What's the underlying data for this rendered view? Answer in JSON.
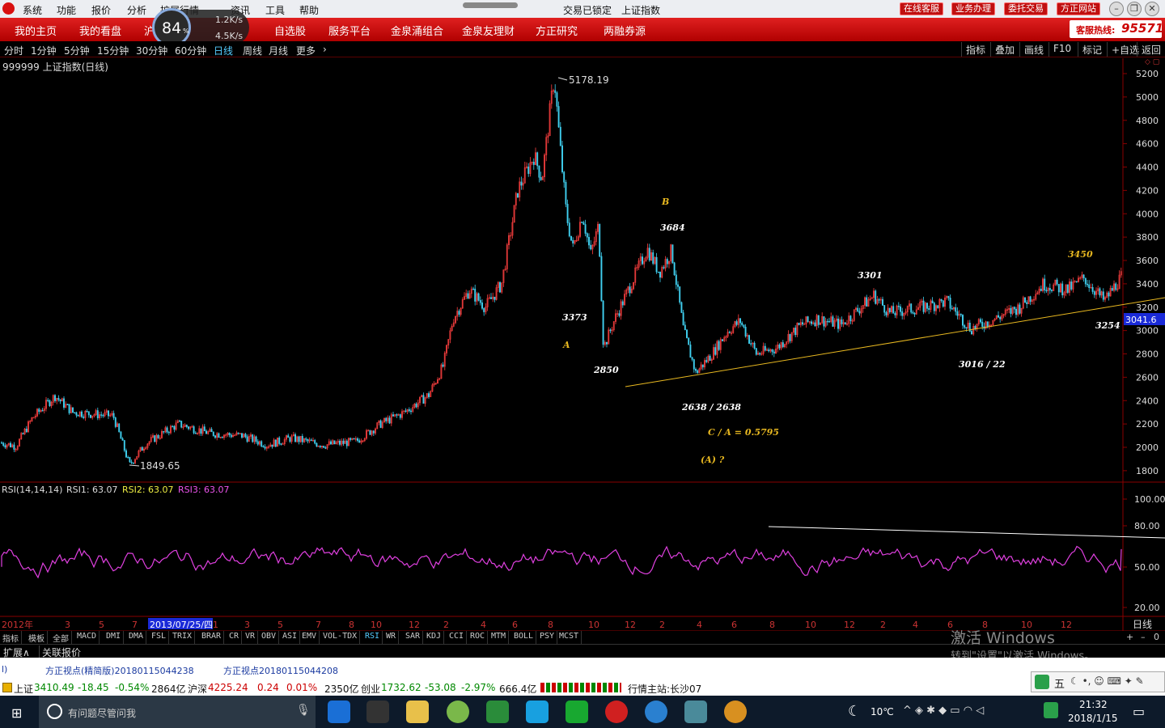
{
  "menu": [
    "系统",
    "功能",
    "报价",
    "分析",
    "扩展行情",
    "资讯",
    "工具",
    "帮助"
  ],
  "window_title": "交易已锁定",
  "index_title": "上证指数",
  "top_buttons": [
    "在线客服",
    "业务办理",
    "委托交易",
    "方正网站"
  ],
  "nav_items": [
    "我的主页",
    "我的看盘",
    "沪深",
    "",
    "自选股",
    "服务平台",
    "金泉涌组合",
    "金泉友理财",
    "方正研究",
    "两融券源"
  ],
  "nav_hidden_label": "沪深",
  "net_meter": {
    "percent": "84",
    "percent_unit": "%",
    "up": "1.2K/s",
    "down": "4.5K/s"
  },
  "hotline": {
    "label": "客服热线:",
    "number": "95571"
  },
  "periods": [
    "分时",
    "1分钟",
    "5分钟",
    "15分钟",
    "30分钟",
    "60分钟",
    "日线",
    "周线",
    "月线",
    "更多"
  ],
  "active_period": "日线",
  "right_tools": [
    "指标",
    "叠加",
    "画线",
    "F10",
    "标记",
    "+自选",
    "返回"
  ],
  "chart_title": "999999 上证指数(日线)",
  "price_axis": [
    "5200",
    "5000",
    "4800",
    "4600",
    "4400",
    "4200",
    "4000",
    "3800",
    "3600",
    "3400",
    "3200",
    "3000",
    "2800",
    "2600",
    "2400",
    "2200",
    "2000",
    "1800"
  ],
  "current_price": "3041.6",
  "price_labels": {
    "high": "5178.19",
    "low": "1849.65"
  },
  "annotations": [
    {
      "text": "B",
      "color": "#e8b820"
    },
    {
      "text": "3684",
      "color": "#ffffff"
    },
    {
      "text": "3373",
      "color": "#ffffff"
    },
    {
      "text": "A",
      "color": "#e8b820"
    },
    {
      "text": "2850",
      "color": "#ffffff"
    },
    {
      "text": "2638 / 2638",
      "color": "#ffffff"
    },
    {
      "text": "C   / A = 0.5795",
      "color": "#e8b820"
    },
    {
      "text": "(A)   ?",
      "color": "#e8b820"
    },
    {
      "text": "3301",
      "color": "#ffffff"
    },
    {
      "text": "3450",
      "color": "#e8b820"
    },
    {
      "text": "3254",
      "color": "#ffffff"
    },
    {
      "text": "3016 / 22",
      "color": "#ffffff"
    }
  ],
  "rsi": {
    "header": "RSI(14,14,14)",
    "rsi1_label": "RSI1:",
    "rsi1": "63.07",
    "rsi2_label": "RSI2:",
    "rsi2": "63.07",
    "rsi3_label": "RSI3:",
    "rsi3": "63.07",
    "axis": [
      "100.00",
      "80.00",
      "50.00",
      "20.00"
    ]
  },
  "date_axis": {
    "year": "2012年",
    "cursor_date": "2013/07/25/四",
    "months": [
      "3",
      "5",
      "7",
      "9",
      "1",
      "3",
      "5",
      "7",
      "8",
      "10",
      "12",
      "2",
      "4",
      "6",
      "8",
      "10",
      "12",
      "2",
      "4",
      "6",
      "8",
      "10",
      "12",
      "2",
      "4",
      "6",
      "8",
      "10",
      "12"
    ],
    "right_label": "日线"
  },
  "indicator_tabs": [
    "指标",
    "模板",
    "全部",
    "MACD",
    "DMI",
    "DMA",
    "FSL",
    "TRIX",
    "BRAR",
    "CR",
    "VR",
    "OBV",
    "ASI",
    "EMV",
    "VOL-TDX",
    "RSI",
    "WR",
    "SAR",
    "KDJ",
    "CCI",
    "ROC",
    "MTM",
    "BOLL",
    "PSY",
    "MCST"
  ],
  "active_indicator": "RSI",
  "expand_tabs": [
    "扩展∧",
    "关联报价"
  ],
  "news": [
    "方正视点(精简版)20180115044238",
    "方正视点20180115044208"
  ],
  "news_prefix": "l)",
  "ticker": {
    "sh_label": "上证",
    "sh_val": "3410.49",
    "sh_chg": "-18.45",
    "sh_pct": "-0.54%",
    "sh_amt": "2864亿",
    "hs_label": "沪深",
    "hs_val": "4225.24",
    "hs_chg": "0.24",
    "hs_pct": "0.01%",
    "hs_amt": "2350亿",
    "cy_label": "创业",
    "cy_val": "1732.62",
    "cy_chg": "-53.08",
    "cy_pct": "-2.97%",
    "cy_amt": "666.4亿",
    "station": "行情主站:长沙07"
  },
  "activate_windows": {
    "line1": "激活 Windows",
    "line2": "转到\"设置\"以激活 Windows。"
  },
  "taskbar": {
    "search_placeholder": "有问题尽管问我",
    "temp": "10℃",
    "time": "21:32",
    "date": "2018/1/15",
    "ime": "五"
  }
}
